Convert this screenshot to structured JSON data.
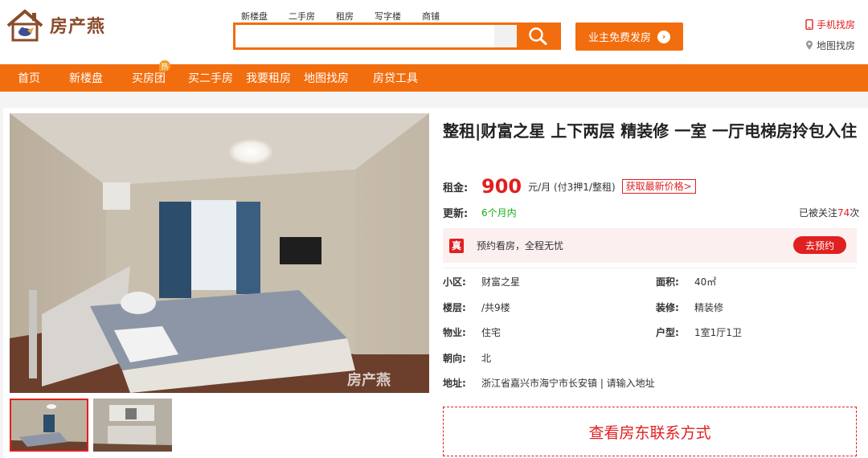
{
  "brand": {
    "name": "房产燕",
    "accent": "#f26d0e",
    "red": "#e02020"
  },
  "search": {
    "tabs": [
      "新楼盘",
      "二手房",
      "租房",
      "写字楼",
      "商铺"
    ],
    "placeholder": "",
    "value": ""
  },
  "header": {
    "publish_label": "业主免费发房",
    "mobile_label": "手机找房",
    "map_label": "地图找房"
  },
  "nav": {
    "items": [
      "首页",
      "新楼盘",
      "买房团",
      "买二手房",
      "我要租房",
      "地图找房",
      "房贷工具"
    ],
    "hot_badge": "热"
  },
  "listing": {
    "title": "整租|财富之星 上下两层 精装修 一室 一厅电梯房拎包入住",
    "rent_label": "租金:",
    "price": "900",
    "price_unit": "元/月 (付3押1/整租)",
    "latest_price": "获取最新价格>",
    "update_label": "更新:",
    "update_value": "6个月内",
    "followers_prefix": "已被关注",
    "followers_count": "74",
    "followers_suffix": "次",
    "appointment_badge": "真",
    "appointment_text": "预约看房，全程无忧",
    "appointment_button": "去预约",
    "details": [
      {
        "k": "小区:",
        "v": "财富之星"
      },
      {
        "k": "面积:",
        "v": "40㎡"
      },
      {
        "k": "楼层:",
        "v": "/共9楼"
      },
      {
        "k": "装修:",
        "v": "精装修"
      },
      {
        "k": "物业:",
        "v": "住宅"
      },
      {
        "k": "户型:",
        "v": "1室1厅1卫"
      },
      {
        "k": "朝向:",
        "v": "北"
      },
      {
        "k": "地址:",
        "v": "浙江省嘉兴市海宁市长安镇 | 请输入地址"
      }
    ],
    "contact_button": "查看房东联系方式",
    "watermark": "房产燕"
  }
}
